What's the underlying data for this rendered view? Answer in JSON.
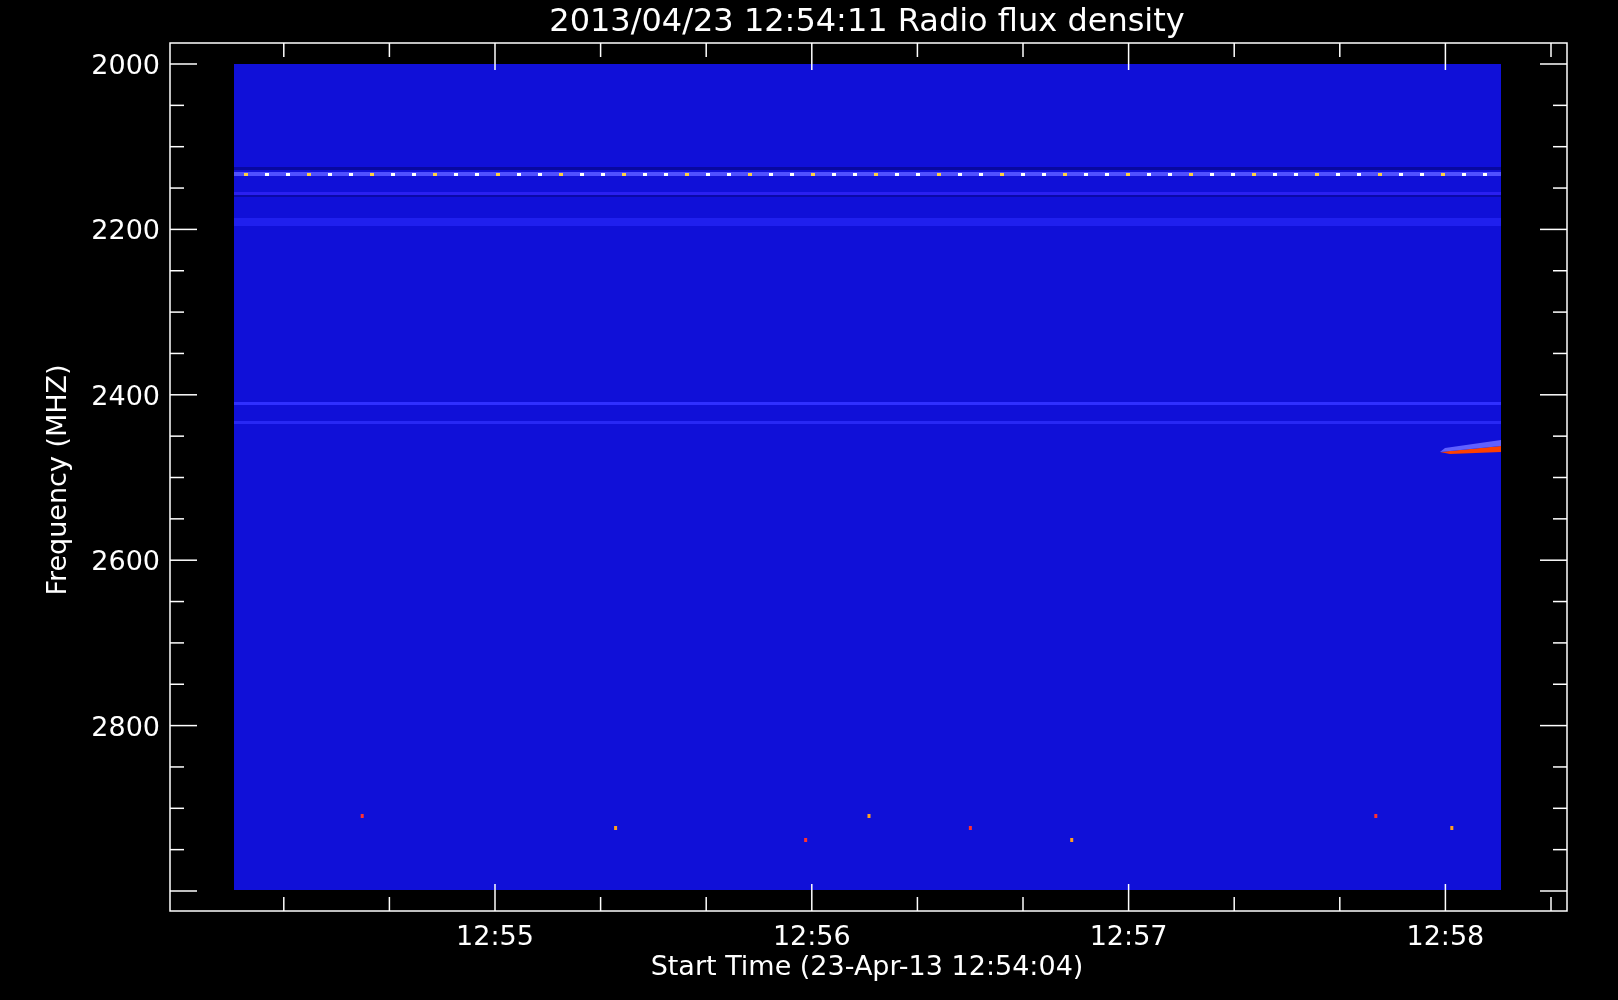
{
  "plot": {
    "title": "2013/04/23 12:54:11 Radio flux density",
    "ylabel": "Frequency (MHZ)",
    "xlabel": "Start Time (23-Apr-13 12:54:04)",
    "yticks": [
      "2000",
      "2200",
      "2400",
      "2600",
      "2800"
    ],
    "xticks": [
      "12:55",
      "12:56",
      "12:57",
      "12:58"
    ]
  }
}
